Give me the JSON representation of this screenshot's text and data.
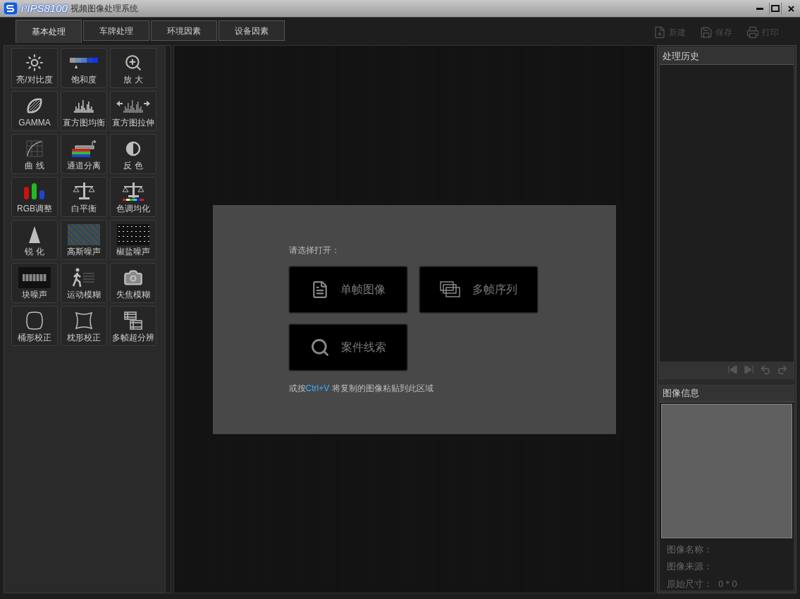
{
  "window": {
    "logo": "i³IPS8100",
    "title": "视频图像处理系统"
  },
  "tabs": [
    {
      "label": "基本处理",
      "selected": true
    },
    {
      "label": "车牌处理",
      "selected": false
    },
    {
      "label": "环境因素",
      "selected": false
    },
    {
      "label": "设备因素",
      "selected": false
    }
  ],
  "toolbar": [
    {
      "kind": "new",
      "label": "新建",
      "disabled": true
    },
    {
      "kind": "save",
      "label": "保存",
      "disabled": true
    },
    {
      "kind": "print",
      "label": "打印",
      "disabled": true
    }
  ],
  "tools": [
    {
      "kind": "brightness",
      "label": "亮/对比度"
    },
    {
      "kind": "saturation",
      "label": "饱和度"
    },
    {
      "kind": "zoom",
      "label": "放 大"
    },
    {
      "kind": "gamma",
      "label": "GAMMA"
    },
    {
      "kind": "histogram",
      "label": "直方图均衡"
    },
    {
      "kind": "stretch",
      "label": "直方图拉伸"
    },
    {
      "kind": "curve",
      "label": "曲 线"
    },
    {
      "kind": "channels",
      "label": "通道分离"
    },
    {
      "kind": "invert",
      "label": "反 色"
    },
    {
      "kind": "rgb",
      "label": "RGB调整"
    },
    {
      "kind": "balance",
      "label": "白平衡"
    },
    {
      "kind": "tone",
      "label": "色调均化"
    },
    {
      "kind": "sharpen",
      "label": "锐 化"
    },
    {
      "kind": "gauss",
      "label": "高斯噪声"
    },
    {
      "kind": "salt",
      "label": "椒盐噪声"
    },
    {
      "kind": "block",
      "label": "块噪声"
    },
    {
      "kind": "motion",
      "label": "运动模糊"
    },
    {
      "kind": "defocus",
      "label": "失焦模糊"
    },
    {
      "kind": "barrel",
      "label": "桶形校正"
    },
    {
      "kind": "pincushion",
      "label": "枕形校正"
    },
    {
      "kind": "film",
      "label": "多帧超分辨"
    }
  ],
  "open_panel": {
    "prompt": "请选择打开：",
    "buttons": [
      {
        "kind": "single",
        "label": "单帧图像"
      },
      {
        "kind": "multi",
        "label": "多帧序列"
      },
      {
        "kind": "case",
        "label": "案件线索"
      }
    ],
    "hint_before": "或按",
    "hint_shortcut": "Ctrl+V",
    "hint_after": " 将复制的图像粘贴到此区域"
  },
  "history": {
    "title": "处理历史"
  },
  "image_info": {
    "title": "图像信息",
    "fields": [
      {
        "label": "图像名称："
      },
      {
        "label": "图像来源："
      },
      {
        "label": "原始尺寸：",
        "value": "0 * 0"
      }
    ]
  }
}
